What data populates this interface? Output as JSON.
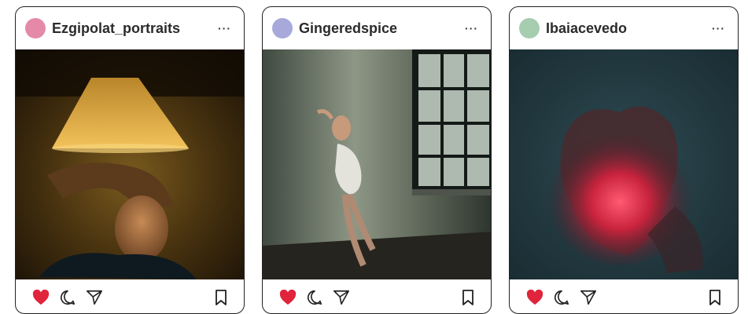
{
  "posts": [
    {
      "username": "Ezgipolat_portraits",
      "avatar_color": "#e48aa8",
      "more_label": "···",
      "liked": true,
      "image_description_icon": "photo-portrait-lamp"
    },
    {
      "username": "Gingeredspice",
      "avatar_color": "#a7a9db",
      "more_label": "···",
      "liked": true,
      "image_description_icon": "photo-woman-window"
    },
    {
      "username": "Ibaiacevedo",
      "avatar_color": "#a6cdb0",
      "more_label": "···",
      "liked": true,
      "image_description_icon": "photo-red-glow-figures"
    }
  ],
  "colors": {
    "like_active": "#e0243b",
    "icon_stroke": "#222222",
    "card_border": "#222222"
  }
}
